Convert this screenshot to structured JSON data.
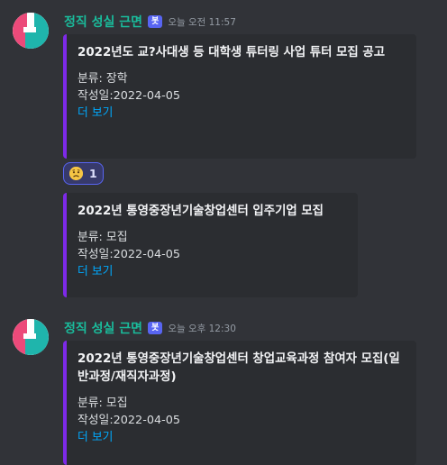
{
  "messages": [
    {
      "username": "정직 성실 근면",
      "bot_tag": "봇",
      "timestamp": "오늘 오전 11:57",
      "embeds": [
        {
          "title": "2022년도 교?사대생 등 대학생 튜터링 사업 튜터 모집 공고",
          "category": "분류: 장학",
          "date": "작성일:2022-04-05",
          "link": "더 보기"
        },
        {
          "title": "2022년 통영중장년기술창업센터 입주기업 모집",
          "category": "분류: 모집",
          "date": "작성일:2022-04-05",
          "link": "더 보기"
        }
      ],
      "reaction": {
        "emoji": "worried-face-icon",
        "count": "1"
      }
    },
    {
      "username": "정직 성실 근면",
      "bot_tag": "봇",
      "timestamp": "오늘 오후 12:30",
      "embeds": [
        {
          "title": "2022년 통영중장년기술창업센터 창업교육과정 참여자 모집(일반과정/재직자과정)",
          "category": "분류: 모집",
          "date": "작성일:2022-04-05",
          "link": "더 보기"
        }
      ]
    }
  ],
  "colors": {
    "background": "#313338",
    "embed_background": "#2b2d31",
    "embed_accent": "#7d2ae8",
    "username": "#1abc9c",
    "link": "#00a8fc",
    "bot_tag": "#5865f2"
  }
}
